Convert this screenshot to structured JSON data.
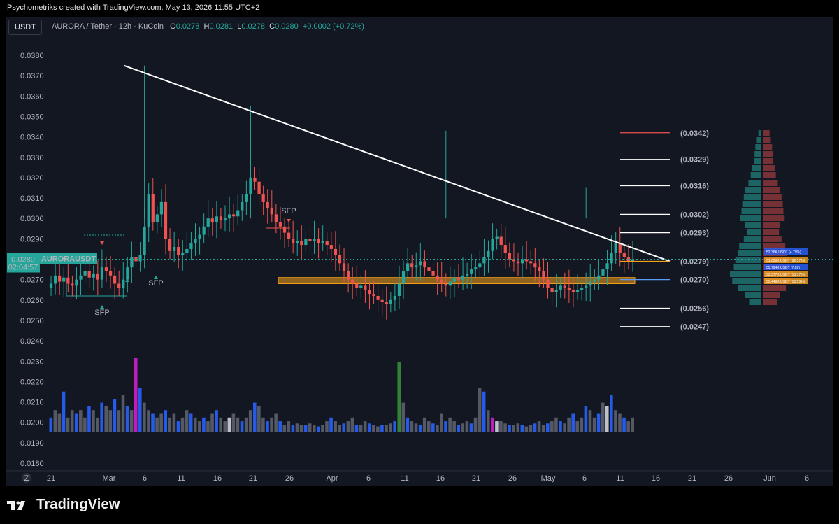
{
  "header": {
    "credit": "Psychometriks created with TradingView.com, May 13, 2026 11:55 UTC+2"
  },
  "toolbar": {
    "currency_button": "USDT"
  },
  "legend": {
    "pair": "AURORA / Tether · 12h · KuCoin",
    "o_label": "O",
    "o_value": "0.0278",
    "h_label": "H",
    "h_value": "0.0281",
    "l_label": "L",
    "l_value": "0.0278",
    "c_label": "C",
    "c_value": "0.0280",
    "change": "+0.0002 (+0.72%)"
  },
  "price_tag": {
    "symbol": "AURORAUSDT",
    "price": "0.0280",
    "countdown": "02:04:57"
  },
  "brand": {
    "name": "TradingView"
  },
  "timezone_button": "Z",
  "colors": {
    "up": "#26a69a",
    "down": "#ef5350",
    "trendline": "#ffffff",
    "zone": "#f7a21b",
    "volume_blue": "#2962ff",
    "volume_magenta": "#d21ed2",
    "volume_grey": "#5d606b",
    "sfp_up": "#26a69a",
    "sfp_down": "#ef5350"
  },
  "chart_data": {
    "type": "candlestick",
    "title": "AURORA / Tether · 12h · KuCoin",
    "y_axis": {
      "ticks": [
        "0.0380",
        "0.0370",
        "0.0360",
        "0.0350",
        "0.0340",
        "0.0330",
        "0.0320",
        "0.0310",
        "0.0300",
        "0.0290",
        "0.0280",
        "0.0270",
        "0.0260",
        "0.0250",
        "0.0240",
        "0.0230",
        "0.0220",
        "0.0210",
        "0.0200",
        "0.0190",
        "0.0180"
      ],
      "range": [
        0.0175,
        0.0385
      ]
    },
    "x_axis": {
      "ticks": [
        "21",
        "Mar",
        "6",
        "11",
        "16",
        "21",
        "26",
        "Apr",
        "6",
        "11",
        "16",
        "21",
        "26",
        "May",
        "6",
        "11",
        "16",
        "21",
        "26",
        "Jun",
        "6"
      ]
    },
    "candles_close_path": [
      0.0268,
      0.0272,
      0.0269,
      0.0271,
      0.0268,
      0.0267,
      0.027,
      0.0272,
      0.0274,
      0.0271,
      0.0273,
      0.027,
      0.0276,
      0.0274,
      0.0272,
      0.0268,
      0.0266,
      0.027,
      0.0276,
      0.0281,
      0.0279,
      0.0282,
      0.0296,
      0.0312,
      0.0298,
      0.0302,
      0.0308,
      0.029,
      0.0284,
      0.0286,
      0.0282,
      0.0283,
      0.0285,
      0.0288,
      0.029,
      0.0292,
      0.0296,
      0.03,
      0.0298,
      0.0301,
      0.0299,
      0.03,
      0.0302,
      0.0301,
      0.0304,
      0.0308,
      0.0312,
      0.032,
      0.0318,
      0.0312,
      0.0308,
      0.0305,
      0.0302,
      0.0298,
      0.0296,
      0.0293,
      0.029,
      0.0288,
      0.0289,
      0.0287,
      0.029,
      0.0289,
      0.029,
      0.0288,
      0.0289,
      0.0287,
      0.0285,
      0.0282,
      0.0278,
      0.0274,
      0.027,
      0.0268,
      0.0266,
      0.0267,
      0.0265,
      0.0263,
      0.0262,
      0.026,
      0.0259,
      0.0258,
      0.026,
      0.0262,
      0.0268,
      0.0274,
      0.0278,
      0.0276,
      0.0277,
      0.0279,
      0.0276,
      0.0274,
      0.0272,
      0.027,
      0.0268,
      0.0267,
      0.0269,
      0.0271,
      0.027,
      0.0272,
      0.0273,
      0.0275,
      0.0276,
      0.0278,
      0.0281,
      0.0284,
      0.029,
      0.0291,
      0.0287,
      0.0283,
      0.028,
      0.0279,
      0.0278,
      0.028,
      0.0279,
      0.0278,
      0.0276,
      0.0274,
      0.027,
      0.0266,
      0.0264,
      0.0265,
      0.0267,
      0.0266,
      0.0265,
      0.0264,
      0.0265,
      0.0266,
      0.0267,
      0.0269,
      0.027,
      0.0272,
      0.0275,
      0.0278,
      0.0283,
      0.0288,
      0.0283,
      0.0281,
      0.0279,
      0.028
    ],
    "trendline": {
      "start": {
        "date": "Mar 4",
        "price": 0.0375
      },
      "end": {
        "date": "May 18",
        "price": 0.0279
      }
    },
    "fib_levels": [
      {
        "label": "(0.0342)",
        "value": 0.0342,
        "color": "#ef5350"
      },
      {
        "label": "(0.0329)",
        "value": 0.0329,
        "color": "#ffffff"
      },
      {
        "label": "(0.0316)",
        "value": 0.0316,
        "color": "#ffffff"
      },
      {
        "label": "(0.0302)",
        "value": 0.0302,
        "color": "#ffffff"
      },
      {
        "label": "(0.0293)",
        "value": 0.0293,
        "color": "#ffffff"
      },
      {
        "label": "(0.0279)",
        "value": 0.0279,
        "color": "#f7a21b"
      },
      {
        "label": "(0.0270)",
        "value": 0.027,
        "color": "#5b9cf6"
      },
      {
        "label": "(0.0256)",
        "value": 0.0256,
        "color": "#ffffff"
      },
      {
        "label": "(0.0247)",
        "value": 0.0247,
        "color": "#ffffff"
      }
    ],
    "support_zone": {
      "low": 0.0268,
      "high": 0.0271
    },
    "annotations": [
      {
        "label": "SFP",
        "color": "#26a69a"
      },
      {
        "label": "SFP",
        "color": "#26a69a"
      },
      {
        "label": "SFP",
        "color": "#ef5350"
      }
    ],
    "volume_scale": [
      0,
      1
    ],
    "volumes": [
      0.2,
      0.3,
      0.25,
      0.55,
      0.2,
      0.3,
      0.25,
      0.3,
      0.2,
      0.35,
      0.3,
      0.2,
      0.4,
      0.35,
      0.3,
      0.45,
      0.3,
      0.5,
      0.35,
      0.3,
      1.0,
      0.6,
      0.4,
      0.3,
      0.25,
      0.2,
      0.25,
      0.3,
      0.2,
      0.25,
      0.15,
      0.2,
      0.3,
      0.25,
      0.2,
      0.15,
      0.2,
      0.15,
      0.25,
      0.3,
      0.2,
      0.15,
      0.2,
      0.25,
      0.2,
      0.15,
      0.2,
      0.3,
      0.4,
      0.35,
      0.2,
      0.15,
      0.2,
      0.25,
      0.15,
      0.1,
      0.15,
      0.1,
      0.12,
      0.1,
      0.1,
      0.12,
      0.1,
      0.08,
      0.1,
      0.15,
      0.2,
      0.15,
      0.1,
      0.12,
      0.15,
      0.2,
      0.1,
      0.1,
      0.15,
      0.12,
      0.1,
      0.08,
      0.1,
      0.1,
      0.12,
      0.15,
      0.95,
      0.4,
      0.2,
      0.15,
      0.12,
      0.1,
      0.2,
      0.15,
      0.12,
      0.1,
      0.25,
      0.15,
      0.2,
      0.15,
      0.1,
      0.12,
      0.15,
      0.12,
      0.2,
      0.6,
      0.55,
      0.3,
      0.2,
      0.15,
      0.15,
      0.12,
      0.1,
      0.1,
      0.12,
      0.1,
      0.08,
      0.1,
      0.12,
      0.15,
      0.1,
      0.12,
      0.15,
      0.2,
      0.15,
      0.12,
      0.2,
      0.25,
      0.15,
      0.2,
      0.35,
      0.3,
      0.2,
      0.25,
      0.4,
      0.35,
      0.5,
      0.3,
      0.25,
      0.2,
      0.15,
      0.2
    ],
    "volume_profile": [
      {
        "label": "52.36K USDT (4.79%)"
      },
      {
        "label": "31.028K USDT (92.37%)"
      },
      {
        "label": "55.794K USDT (7.89)"
      },
      {
        "label": "33.377K USDT (13.37%)"
      },
      {
        "label": "55.448K USDT (15.53%)"
      }
    ]
  }
}
